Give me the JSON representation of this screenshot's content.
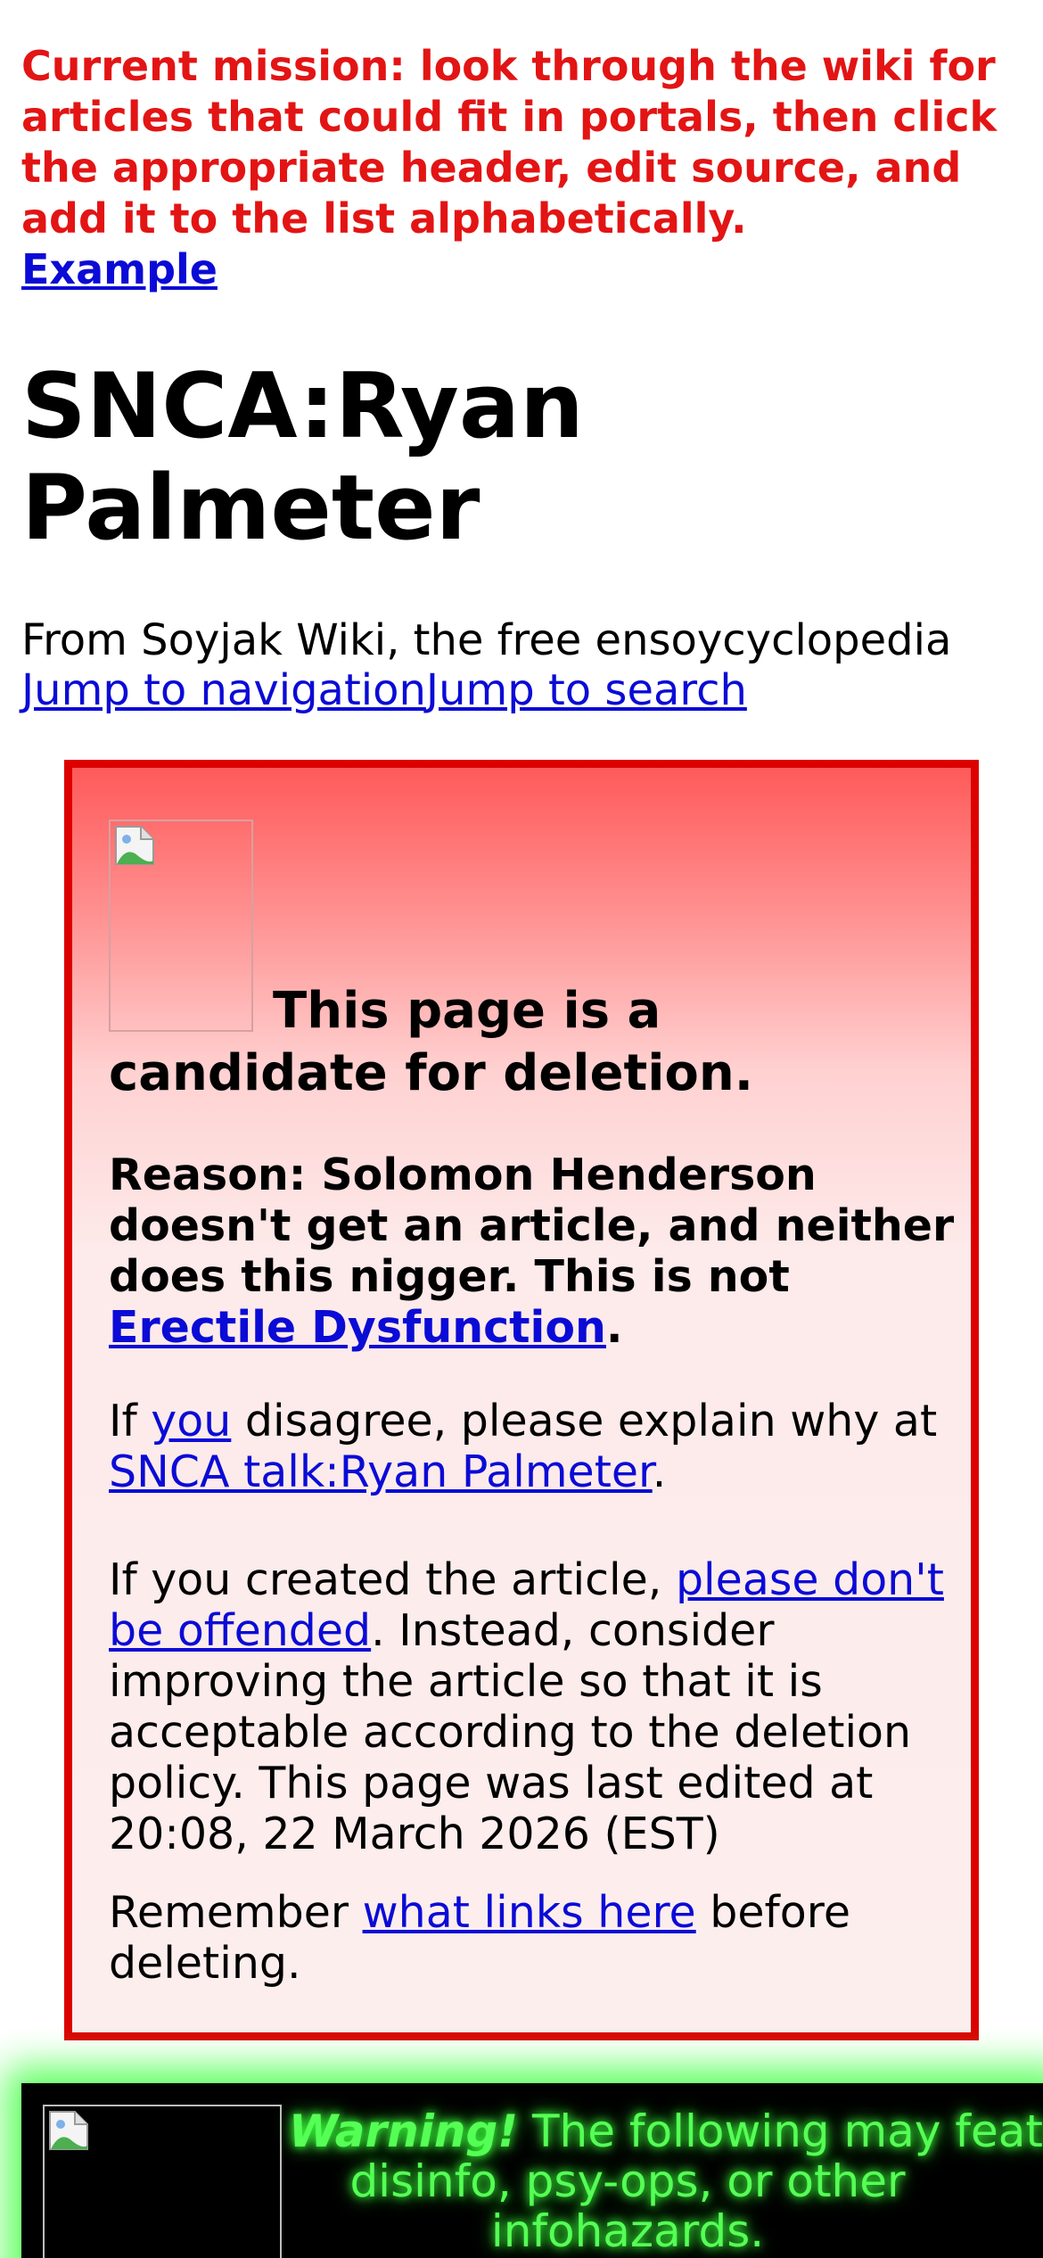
{
  "banner": {
    "mission_text": "Current mission: look through the wiki for articles that could fit in portals, then click the appropriate header, edit source, and add it to the list alphabetically.",
    "example_link": "Example"
  },
  "page": {
    "title": "SNCA:Ryan Palmeter",
    "tagline": "From Soyjak Wiki, the free ensoycyclopedia",
    "jump_navigation": "Jump to navigation",
    "jump_search": "Jump to search"
  },
  "deletion_notice": {
    "heading": "This page is a candidate for deletion.",
    "reason_text": "Reason: Solomon Henderson doesn't get an article, and neither does this nigger. This is not",
    "reason_link": "Erectile Dysfunction",
    "reason_end": ".",
    "disagree": {
      "pre": "If ",
      "you_link": "you",
      "mid": " disagree, please explain why at",
      "talk_link": "SNCA talk:Ryan Palmeter",
      "end": "."
    },
    "created": {
      "pre": "If you created the article, ",
      "offended_link": "please don't be offended",
      "post": ". Instead, consider improving the article so that it is acceptable according to the deletion policy. This page was last edited at 20:08, 22 March 2026 (EST)"
    },
    "remember": {
      "pre": "Remember ",
      "links_link": "what links here",
      "post": " before deleting."
    },
    "colors": {
      "border": "#dc0000",
      "top": "#ff5a5a",
      "bottom": "#fdeeee"
    }
  },
  "warning_box": {
    "warning_label": "Warning!",
    "warning_text_line1": " The following may feature",
    "warning_text_line2": "disinfo, psy-ops, or other",
    "warning_text_line3": "infohazards.",
    "colors": {
      "text": "#55ff55",
      "glow": "#5dff5d",
      "background": "#000000"
    }
  },
  "icons": [
    "broken-image-icon"
  ]
}
